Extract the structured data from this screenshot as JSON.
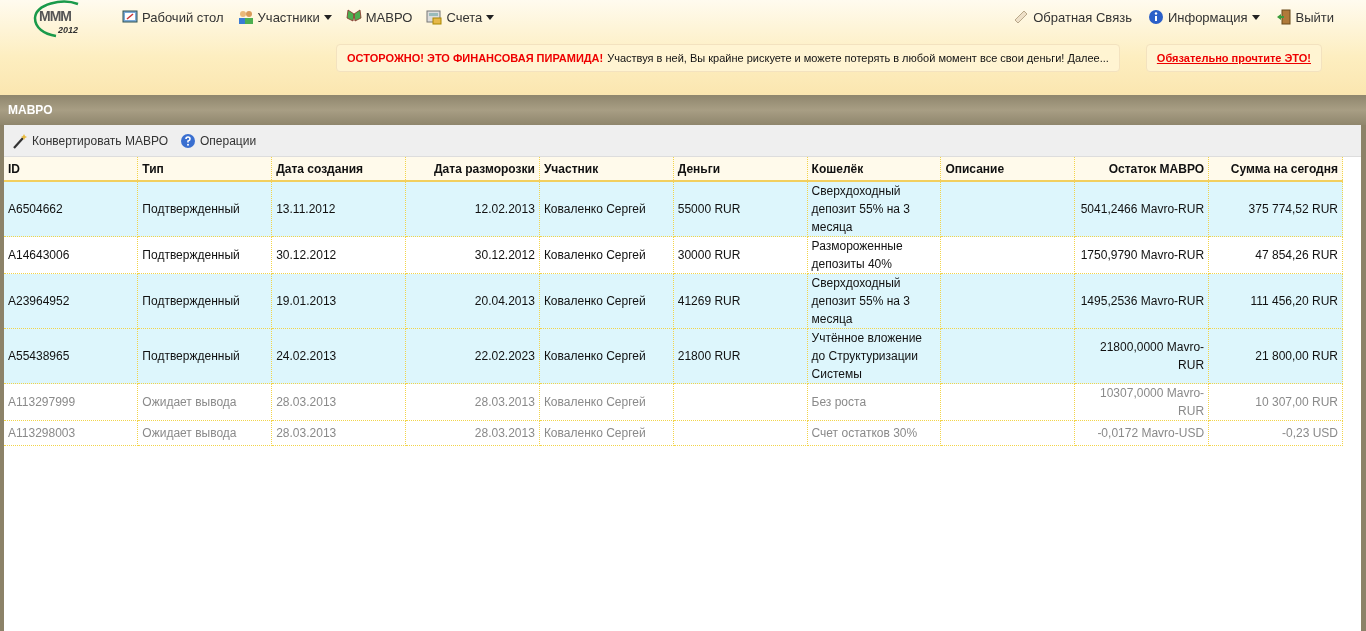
{
  "logo": {
    "mark": "MMM",
    "year": "2012"
  },
  "nav_left": [
    {
      "label": "Рабочий стол",
      "has_menu": false
    },
    {
      "label": "Участники",
      "has_menu": true
    },
    {
      "label": "МАВРО",
      "has_menu": false
    },
    {
      "label": "Счета",
      "has_menu": true
    }
  ],
  "nav_right": [
    {
      "label": "Обратная Связь",
      "has_menu": false
    },
    {
      "label": "Информация",
      "has_menu": true
    },
    {
      "label": "Выйти",
      "has_menu": false
    }
  ],
  "warning": {
    "alert": "ОСТОРОЖНО! ЭТО ФИНАНСОВАЯ ПИРАМИДА!",
    "text": "Участвуя в ней, Вы крайне рискуете и можете потерять в любой момент все свои деньги! Далее..."
  },
  "must_read_link": "Обязательно прочтите ЭТО!",
  "panel": {
    "title": "МАВРО",
    "toolbar": [
      "Конвертировать МАВРО",
      "Операции"
    ],
    "table": {
      "columns": [
        "ID",
        "Тип",
        "Дата создания",
        "Дата разморозки",
        "Участник",
        "Деньги",
        "Кошелёк",
        "Описание",
        "Остаток МАВРО",
        "Сумма на сегодня"
      ],
      "rows": [
        {
          "highlighted": true,
          "disabled": false,
          "cells": [
            "A6504662",
            "Подтвержденный",
            "13.11.2012",
            "12.02.2013",
            "Коваленко Сергей",
            "55000 RUR",
            "Сверхдоходный депозит 55% на 3 месяца",
            "",
            "5041,2466 Mavro-RUR",
            "375 774,52 RUR"
          ]
        },
        {
          "highlighted": false,
          "disabled": false,
          "cells": [
            "A14643006",
            "Подтвержденный",
            "30.12.2012",
            "30.12.2012",
            "Коваленко Сергей",
            "30000 RUR",
            "Размороженные депозиты 40%",
            "",
            "1750,9790 Mavro-RUR",
            "47 854,26 RUR"
          ]
        },
        {
          "highlighted": true,
          "disabled": false,
          "cells": [
            "A23964952",
            "Подтвержденный",
            "19.01.2013",
            "20.04.2013",
            "Коваленко Сергей",
            "41269 RUR",
            "Сверхдоходный депозит 55% на 3 месяца",
            "",
            "1495,2536 Mavro-RUR",
            "111 456,20 RUR"
          ]
        },
        {
          "highlighted": true,
          "disabled": false,
          "cells": [
            "A55438965",
            "Подтвержденный",
            "24.02.2013",
            "22.02.2023",
            "Коваленко Сергей",
            "21800 RUR",
            "Учтённое вложение до Структуризации Системы",
            "",
            "21800,0000 Mavro-RUR",
            "21 800,00 RUR"
          ]
        },
        {
          "highlighted": false,
          "disabled": true,
          "cells": [
            "A113297999",
            "Ожидает вывода",
            "28.03.2013",
            "28.03.2013",
            "Коваленко Сергей",
            "",
            "Без роста",
            "",
            "10307,0000 Mavro-RUR",
            "10 307,00 RUR"
          ]
        },
        {
          "highlighted": false,
          "disabled": true,
          "cells": [
            "A113298003",
            "Ожидает вывода",
            "28.03.2013",
            "28.03.2013",
            "Коваленко Сергей",
            "",
            "Счет остатков 30%",
            "",
            "-0,0172 Mavro-USD",
            "-0,23 USD"
          ]
        }
      ]
    }
  }
}
